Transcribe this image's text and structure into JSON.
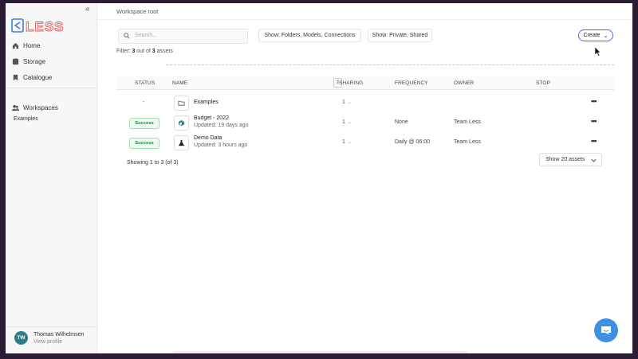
{
  "sidebar": {
    "brand": "LESS",
    "nav": [
      {
        "label": "Home",
        "icon": "home-icon"
      },
      {
        "label": "Storage",
        "icon": "database-icon"
      },
      {
        "label": "Catalogue",
        "icon": "bookmark-icon"
      }
    ],
    "workspaces_label": "Workspaces",
    "workspace_item": "Examples",
    "profile": {
      "initials": "TW",
      "name": "Thomas Wilhelmsen",
      "link": "View profile"
    }
  },
  "header": {
    "breadcrumb": "Workspace root"
  },
  "toolbar": {
    "search_placeholder": "Search...",
    "filter_types_prefix": "Show: ",
    "filter_types": "Folders, Models, Connections",
    "filter_visibility_prefix": "Show: ",
    "filter_visibility": "Private, Shared",
    "create_label": "Create"
  },
  "filter_summary": {
    "prefix": "Filter: ",
    "shown": "3",
    "middle": " out of ",
    "total": "3",
    "suffix": " assets"
  },
  "table": {
    "columns": [
      "STATUS",
      "NAME",
      "SHARING",
      "FREQUENCY",
      "OWNER",
      "STOP"
    ],
    "rows": [
      {
        "status": "-",
        "name": "Examples",
        "updated": "",
        "sharing": "1",
        "frequency": "",
        "owner": "",
        "icon": "folder-icon"
      },
      {
        "status": "Success",
        "name": "Budget - 2022",
        "updated": "Updated: 19 days ago",
        "sharing": "1",
        "frequency": "None",
        "owner": "Team Less",
        "icon": "model-icon"
      },
      {
        "status": "Success",
        "name": "Demo Data",
        "updated": "Updated: 3 hours ago",
        "sharing": "1",
        "frequency": "Daily @ 06:00",
        "owner": "Team Less",
        "icon": "flask-icon"
      }
    ]
  },
  "pagination": {
    "showing": "Showing 1 to 3 (of 3)",
    "page_size": "Show 20 assets"
  },
  "colors": {
    "accent": "#4b6bd6",
    "success": "#1e8a45",
    "brand_red": "#e85a5a",
    "chat": "#3f90e0"
  }
}
